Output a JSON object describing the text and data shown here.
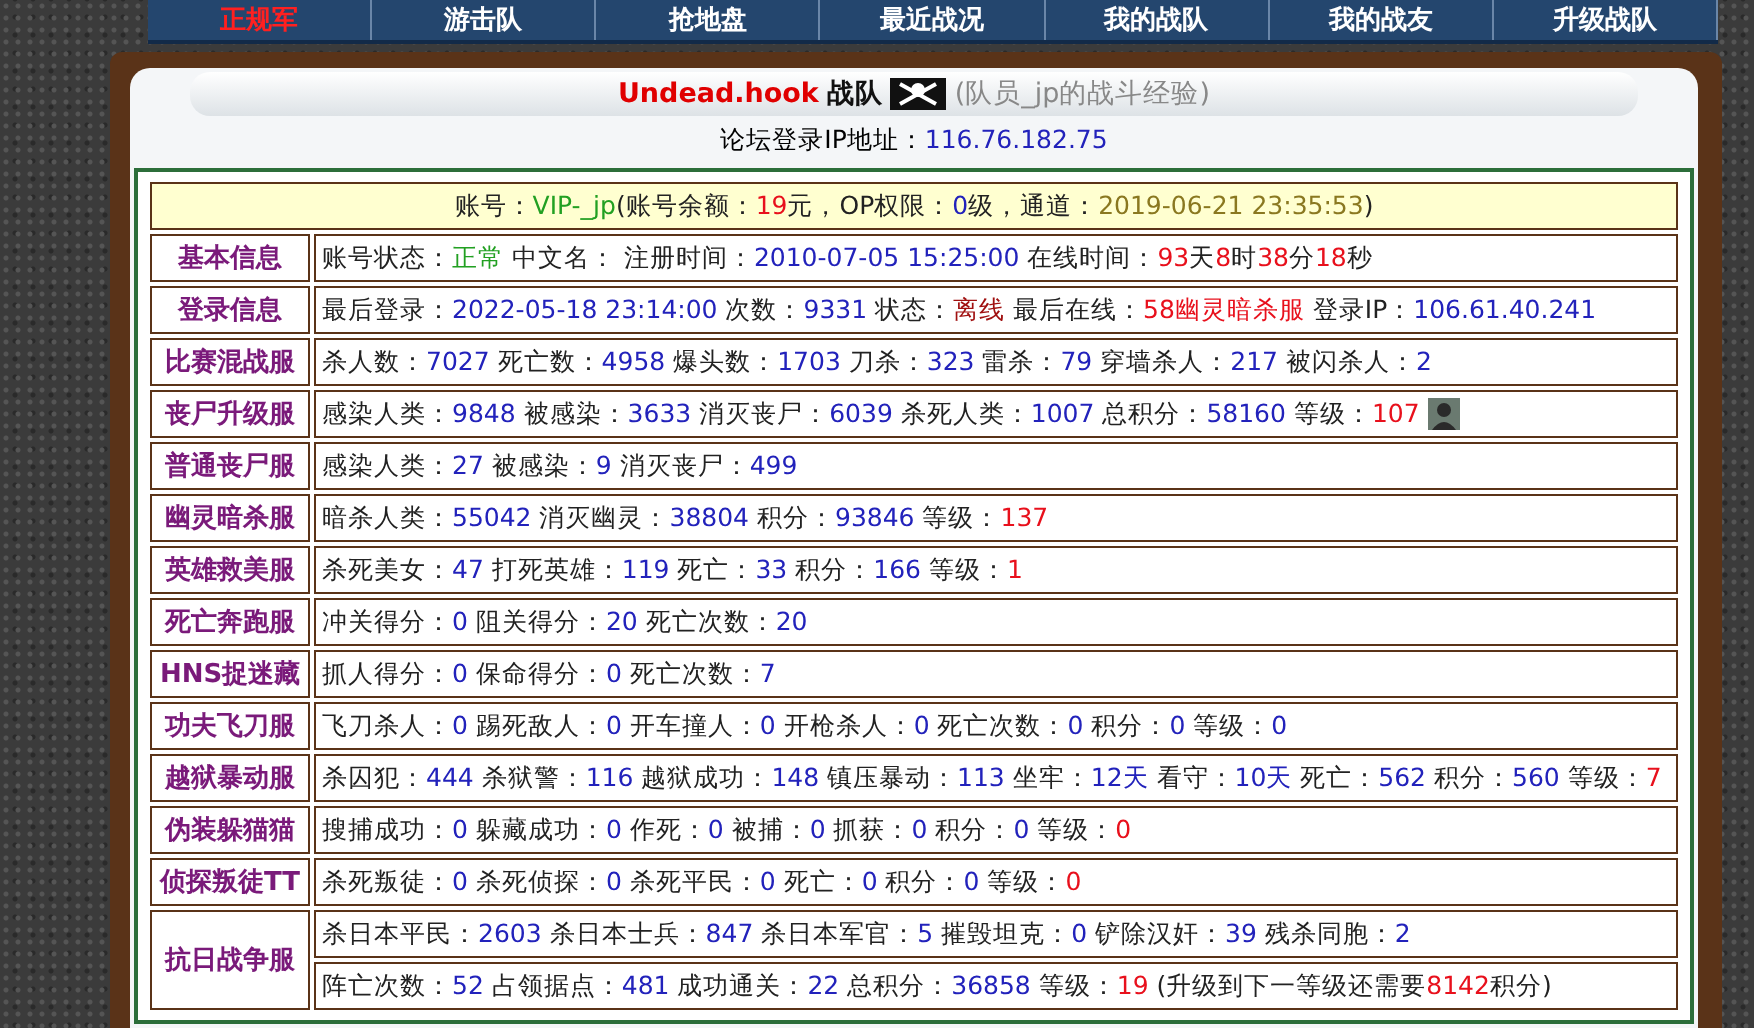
{
  "nav": [
    {
      "label": "正规军",
      "selected": true
    },
    {
      "label": "游击队",
      "selected": false
    },
    {
      "label": "抢地盘",
      "selected": false
    },
    {
      "label": "最近战况",
      "selected": false
    },
    {
      "label": "我的战队",
      "selected": false
    },
    {
      "label": "我的战友",
      "selected": false
    },
    {
      "label": "升级战队",
      "selected": false
    }
  ],
  "header": {
    "team": "Undead.hook",
    "team_suffix": "战队",
    "member_note": "(队员_jp的战斗经验)"
  },
  "forum_ip": {
    "label": "论坛登录IP地址：",
    "value": "116.76.182.75"
  },
  "account": [
    {
      "text": "账号：",
      "color": "#222222"
    },
    {
      "text": "VIP-_jp",
      "color": "#22a022"
    },
    {
      "text": "(账号余额：",
      "color": "#222222"
    },
    {
      "text": "19",
      "color": "#e8101c"
    },
    {
      "text": "元，OP权限：",
      "color": "#222222"
    },
    {
      "text": "0",
      "color": "#2222bb"
    },
    {
      "text": "级，通道：",
      "color": "#222222"
    },
    {
      "text": "2019-06-21 23:35:53",
      "color": "#8a7820"
    },
    {
      "text": ")",
      "color": "#222222"
    }
  ],
  "rows": [
    {
      "server": "基本信息",
      "lines": [
        [
          {
            "text": "账号状态：",
            "color": "#222222"
          },
          {
            "text": "正常",
            "color": "#22a022"
          },
          {
            "text": " 中文名： 注册时间：",
            "color": "#222222"
          },
          {
            "text": "2010-07-05 15:25:00",
            "color": "#2222bb"
          },
          {
            "text": " 在线时间：",
            "color": "#222222"
          },
          {
            "text": "93",
            "color": "#e8101c"
          },
          {
            "text": "天",
            "color": "#222222"
          },
          {
            "text": "8",
            "color": "#e8101c"
          },
          {
            "text": "时",
            "color": "#222222"
          },
          {
            "text": "38",
            "color": "#e8101c"
          },
          {
            "text": "分",
            "color": "#222222"
          },
          {
            "text": "18",
            "color": "#e8101c"
          },
          {
            "text": "秒",
            "color": "#222222"
          }
        ]
      ]
    },
    {
      "server": "登录信息",
      "lines": [
        [
          {
            "text": "最后登录：",
            "color": "#222222"
          },
          {
            "text": "2022-05-18 23:14:00",
            "color": "#2222bb"
          },
          {
            "text": " 次数：",
            "color": "#222222"
          },
          {
            "text": "9331",
            "color": "#2222bb"
          },
          {
            "text": " 状态：",
            "color": "#222222"
          },
          {
            "text": "离线",
            "color": "#a01010"
          },
          {
            "text": " 最后在线：",
            "color": "#222222"
          },
          {
            "text": "58幽灵暗杀服",
            "color": "#e8101c"
          },
          {
            "text": " 登录IP：",
            "color": "#222222"
          },
          {
            "text": "106.61.40.241",
            "color": "#2222bb"
          }
        ]
      ]
    },
    {
      "server": "比赛混战服",
      "lines": [
        [
          {
            "text": "杀人数：",
            "color": "#222222"
          },
          {
            "text": "7027",
            "color": "#2222bb"
          },
          {
            "text": " 死亡数：",
            "color": "#222222"
          },
          {
            "text": "4958",
            "color": "#2222bb"
          },
          {
            "text": " 爆头数：",
            "color": "#222222"
          },
          {
            "text": "1703",
            "color": "#2222bb"
          },
          {
            "text": " 刀杀：",
            "color": "#222222"
          },
          {
            "text": "323",
            "color": "#2222bb"
          },
          {
            "text": " 雷杀：",
            "color": "#222222"
          },
          {
            "text": "79",
            "color": "#2222bb"
          },
          {
            "text": " 穿墙杀人：",
            "color": "#222222"
          },
          {
            "text": "217",
            "color": "#2222bb"
          },
          {
            "text": " 被闪杀人：",
            "color": "#222222"
          },
          {
            "text": "2",
            "color": "#2222bb"
          }
        ]
      ]
    },
    {
      "server": "丧尸升级服",
      "avatar": true,
      "lines": [
        [
          {
            "text": "感染人类：",
            "color": "#222222"
          },
          {
            "text": "9848",
            "color": "#2222bb"
          },
          {
            "text": " 被感染：",
            "color": "#222222"
          },
          {
            "text": "3633",
            "color": "#2222bb"
          },
          {
            "text": " 消灭丧尸：",
            "color": "#222222"
          },
          {
            "text": "6039",
            "color": "#2222bb"
          },
          {
            "text": " 杀死人类：",
            "color": "#222222"
          },
          {
            "text": "1007",
            "color": "#2222bb"
          },
          {
            "text": " 总积分：",
            "color": "#222222"
          },
          {
            "text": "58160",
            "color": "#2222bb"
          },
          {
            "text": " 等级：",
            "color": "#222222"
          },
          {
            "text": "107",
            "color": "#e8101c"
          }
        ]
      ]
    },
    {
      "server": "普通丧尸服",
      "lines": [
        [
          {
            "text": "感染人类：",
            "color": "#222222"
          },
          {
            "text": "27",
            "color": "#2222bb"
          },
          {
            "text": " 被感染：",
            "color": "#222222"
          },
          {
            "text": "9",
            "color": "#2222bb"
          },
          {
            "text": " 消灭丧尸：",
            "color": "#222222"
          },
          {
            "text": "499",
            "color": "#2222bb"
          }
        ]
      ]
    },
    {
      "server": "幽灵暗杀服",
      "lines": [
        [
          {
            "text": "暗杀人类：",
            "color": "#222222"
          },
          {
            "text": "55042",
            "color": "#2222bb"
          },
          {
            "text": " 消灭幽灵：",
            "color": "#222222"
          },
          {
            "text": "38804",
            "color": "#2222bb"
          },
          {
            "text": " 积分：",
            "color": "#222222"
          },
          {
            "text": "93846",
            "color": "#2222bb"
          },
          {
            "text": " 等级：",
            "color": "#222222"
          },
          {
            "text": "137",
            "color": "#e8101c"
          }
        ]
      ]
    },
    {
      "server": "英雄救美服",
      "lines": [
        [
          {
            "text": "杀死美女：",
            "color": "#222222"
          },
          {
            "text": "47",
            "color": "#2222bb"
          },
          {
            "text": " 打死英雄：",
            "color": "#222222"
          },
          {
            "text": "119",
            "color": "#2222bb"
          },
          {
            "text": " 死亡：",
            "color": "#222222"
          },
          {
            "text": "33",
            "color": "#2222bb"
          },
          {
            "text": " 积分：",
            "color": "#222222"
          },
          {
            "text": "166",
            "color": "#2222bb"
          },
          {
            "text": " 等级：",
            "color": "#222222"
          },
          {
            "text": "1",
            "color": "#e8101c"
          }
        ]
      ]
    },
    {
      "server": "死亡奔跑服",
      "lines": [
        [
          {
            "text": "冲关得分：",
            "color": "#222222"
          },
          {
            "text": "0",
            "color": "#2222bb"
          },
          {
            "text": " 阻关得分：",
            "color": "#222222"
          },
          {
            "text": "20",
            "color": "#2222bb"
          },
          {
            "text": " 死亡次数：",
            "color": "#222222"
          },
          {
            "text": "20",
            "color": "#2222bb"
          }
        ]
      ]
    },
    {
      "server": "HNS捉迷藏",
      "lines": [
        [
          {
            "text": "抓人得分：",
            "color": "#222222"
          },
          {
            "text": "0",
            "color": "#2222bb"
          },
          {
            "text": " 保命得分：",
            "color": "#222222"
          },
          {
            "text": "0",
            "color": "#2222bb"
          },
          {
            "text": " 死亡次数：",
            "color": "#222222"
          },
          {
            "text": "7",
            "color": "#2222bb"
          }
        ]
      ]
    },
    {
      "server": "功夫飞刀服",
      "lines": [
        [
          {
            "text": "飞刀杀人：",
            "color": "#222222"
          },
          {
            "text": "0",
            "color": "#2222bb"
          },
          {
            "text": " 踢死敌人：",
            "color": "#222222"
          },
          {
            "text": "0",
            "color": "#2222bb"
          },
          {
            "text": " 开车撞人：",
            "color": "#222222"
          },
          {
            "text": "0",
            "color": "#2222bb"
          },
          {
            "text": " 开枪杀人：",
            "color": "#222222"
          },
          {
            "text": "0",
            "color": "#2222bb"
          },
          {
            "text": " 死亡次数：",
            "color": "#222222"
          },
          {
            "text": "0",
            "color": "#2222bb"
          },
          {
            "text": " 积分：",
            "color": "#222222"
          },
          {
            "text": "0",
            "color": "#2222bb"
          },
          {
            "text": " 等级：",
            "color": "#222222"
          },
          {
            "text": "0",
            "color": "#2222bb"
          }
        ]
      ]
    },
    {
      "server": "越狱暴动服",
      "lines": [
        [
          {
            "text": "杀囚犯：",
            "color": "#222222"
          },
          {
            "text": "444",
            "color": "#2222bb"
          },
          {
            "text": " 杀狱警：",
            "color": "#222222"
          },
          {
            "text": "116",
            "color": "#2222bb"
          },
          {
            "text": " 越狱成功：",
            "color": "#222222"
          },
          {
            "text": "148",
            "color": "#2222bb"
          },
          {
            "text": " 镇压暴动：",
            "color": "#222222"
          },
          {
            "text": "113",
            "color": "#2222bb"
          },
          {
            "text": " 坐牢：",
            "color": "#222222"
          },
          {
            "text": "12天",
            "color": "#2222bb"
          },
          {
            "text": " 看守：",
            "color": "#222222"
          },
          {
            "text": "10天",
            "color": "#2222bb"
          },
          {
            "text": " 死亡：",
            "color": "#222222"
          },
          {
            "text": "562",
            "color": "#2222bb"
          },
          {
            "text": " 积分：",
            "color": "#222222"
          },
          {
            "text": "560",
            "color": "#2222bb"
          },
          {
            "text": " 等级：",
            "color": "#222222"
          },
          {
            "text": "7",
            "color": "#e8101c"
          }
        ]
      ]
    },
    {
      "server": "伪装躲猫猫",
      "lines": [
        [
          {
            "text": "搜捕成功：",
            "color": "#222222"
          },
          {
            "text": "0",
            "color": "#2222bb"
          },
          {
            "text": " 躲藏成功：",
            "color": "#222222"
          },
          {
            "text": "0",
            "color": "#2222bb"
          },
          {
            "text": " 作死：",
            "color": "#222222"
          },
          {
            "text": "0",
            "color": "#2222bb"
          },
          {
            "text": " 被捕：",
            "color": "#222222"
          },
          {
            "text": "0",
            "color": "#2222bb"
          },
          {
            "text": " 抓获：",
            "color": "#222222"
          },
          {
            "text": "0",
            "color": "#2222bb"
          },
          {
            "text": " 积分：",
            "color": "#222222"
          },
          {
            "text": "0",
            "color": "#2222bb"
          },
          {
            "text": " 等级：",
            "color": "#222222"
          },
          {
            "text": "0",
            "color": "#e8101c"
          }
        ]
      ]
    },
    {
      "server": "侦探叛徒TT",
      "lines": [
        [
          {
            "text": "杀死叛徒：",
            "color": "#222222"
          },
          {
            "text": "0",
            "color": "#2222bb"
          },
          {
            "text": " 杀死侦探：",
            "color": "#222222"
          },
          {
            "text": "0",
            "color": "#2222bb"
          },
          {
            "text": " 杀死平民：",
            "color": "#222222"
          },
          {
            "text": "0",
            "color": "#2222bb"
          },
          {
            "text": " 死亡：",
            "color": "#222222"
          },
          {
            "text": "0",
            "color": "#2222bb"
          },
          {
            "text": " 积分：",
            "color": "#222222"
          },
          {
            "text": "0",
            "color": "#2222bb"
          },
          {
            "text": " 等级：",
            "color": "#222222"
          },
          {
            "text": "0",
            "color": "#e8101c"
          }
        ]
      ]
    },
    {
      "server": "抗日战争服",
      "lines": [
        [
          {
            "text": "杀日本平民：",
            "color": "#222222"
          },
          {
            "text": "2603",
            "color": "#2222bb"
          },
          {
            "text": " 杀日本士兵：",
            "color": "#222222"
          },
          {
            "text": "847",
            "color": "#2222bb"
          },
          {
            "text": " 杀日本军官：",
            "color": "#222222"
          },
          {
            "text": "5",
            "color": "#2222bb"
          },
          {
            "text": " 摧毁坦克：",
            "color": "#222222"
          },
          {
            "text": "0",
            "color": "#2222bb"
          },
          {
            "text": " 铲除汉奸：",
            "color": "#222222"
          },
          {
            "text": "39",
            "color": "#2222bb"
          },
          {
            "text": " 残杀同胞：",
            "color": "#222222"
          },
          {
            "text": "2",
            "color": "#2222bb"
          }
        ],
        [
          {
            "text": "阵亡次数：",
            "color": "#222222"
          },
          {
            "text": "52",
            "color": "#2222bb"
          },
          {
            "text": " 占领据点：",
            "color": "#222222"
          },
          {
            "text": "481",
            "color": "#2222bb"
          },
          {
            "text": " 成功通关：",
            "color": "#222222"
          },
          {
            "text": "22",
            "color": "#2222bb"
          },
          {
            "text": " 总积分：",
            "color": "#222222"
          },
          {
            "text": "36858",
            "color": "#2222bb"
          },
          {
            "text": " 等级：",
            "color": "#222222"
          },
          {
            "text": "19",
            "color": "#e8101c"
          },
          {
            "text": " (升级到下一等级还需要",
            "color": "#222222"
          },
          {
            "text": "8142",
            "color": "#e8101c"
          },
          {
            "text": "积分)",
            "color": "#222222"
          }
        ]
      ]
    }
  ]
}
